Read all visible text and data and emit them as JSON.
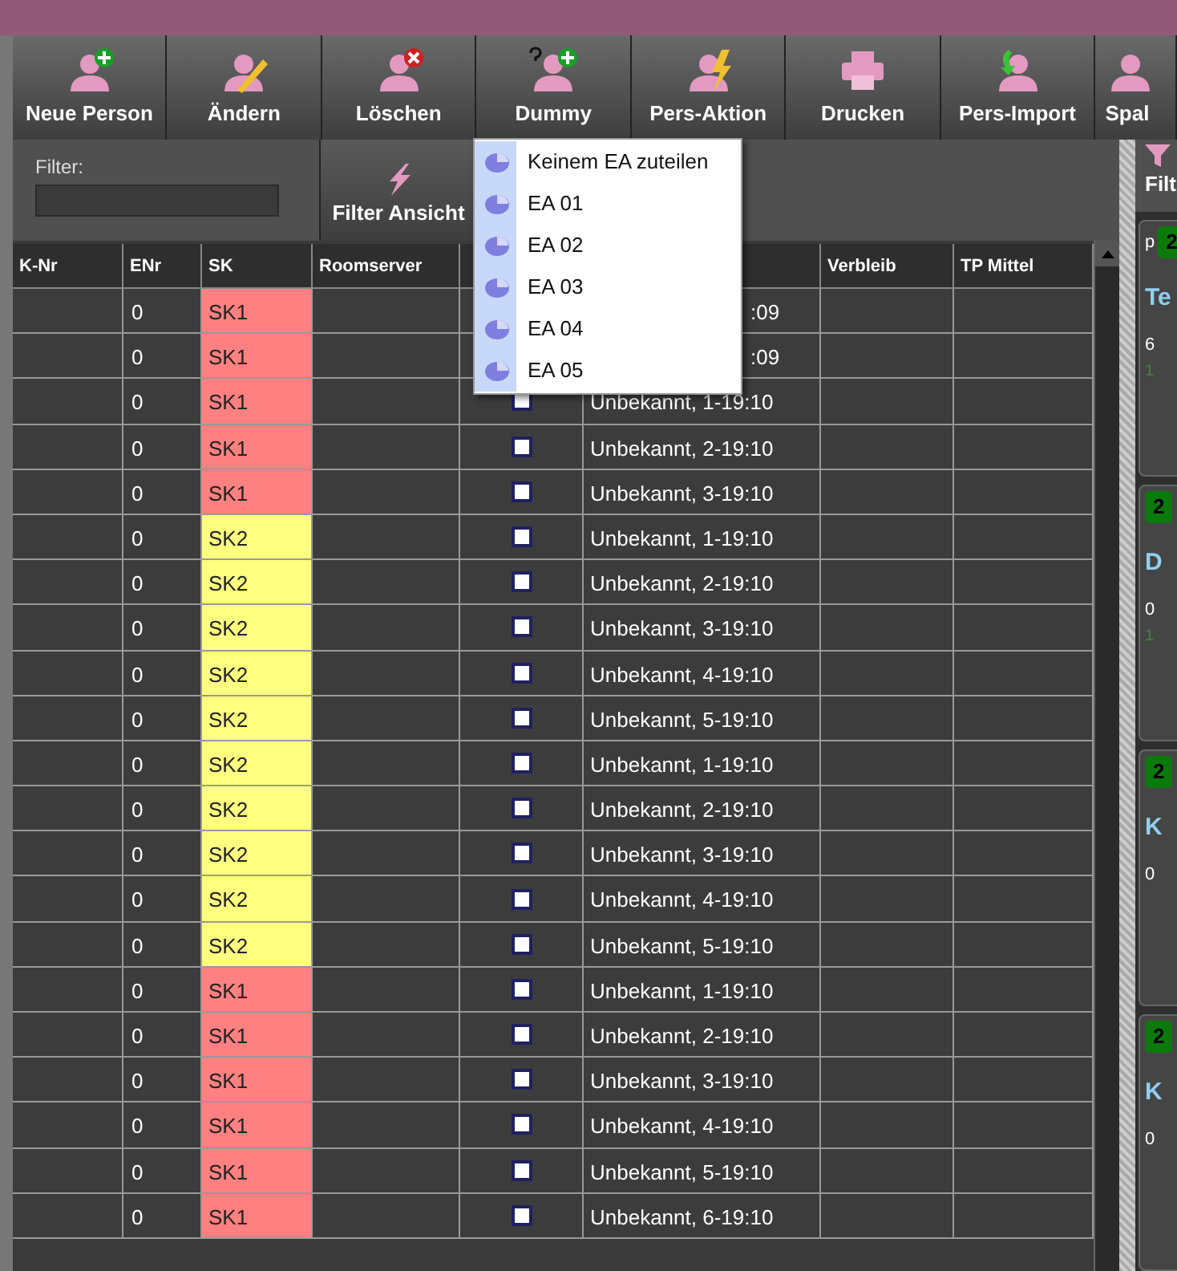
{
  "toolbar": [
    {
      "label": "Neue Person",
      "kind": "add"
    },
    {
      "label": "Ändern",
      "kind": "edit"
    },
    {
      "label": "Löschen",
      "kind": "delete"
    },
    {
      "label": "Dummy",
      "kind": "dummy"
    },
    {
      "label": "Pers-Aktion",
      "kind": "action"
    },
    {
      "label": "Drucken",
      "kind": "print"
    },
    {
      "label": "Pers-Import",
      "kind": "import"
    },
    {
      "label": "Spal",
      "kind": "columns"
    }
  ],
  "filter": {
    "label": "Filter:",
    "button": "Filter Ansicht"
  },
  "right_filter_button": "Filt",
  "menu": [
    "Keinem EA zuteilen",
    "EA 01",
    "EA 02",
    "EA 03",
    "EA 04",
    "EA 05"
  ],
  "table": {
    "columns": [
      "K-Nr",
      "ENr",
      "SK",
      "Roomserver",
      "",
      "",
      "Verbleib",
      "TP Mittel"
    ],
    "rows": [
      {
        "enr": "0",
        "sk": "SK1",
        "color": "#ff8080",
        "covered": true,
        "status": ":09"
      },
      {
        "enr": "0",
        "sk": "SK1",
        "color": "#ff8080",
        "covered": true,
        "status": ":09"
      },
      {
        "enr": "0",
        "sk": "SK1",
        "color": "#ff8080",
        "covered": false,
        "checked": false,
        "status": "Unbekannt, 1-19:10"
      },
      {
        "enr": "0",
        "sk": "SK1",
        "color": "#ff8080",
        "covered": false,
        "checked": false,
        "status": "Unbekannt, 2-19:10"
      },
      {
        "enr": "0",
        "sk": "SK1",
        "color": "#ff8080",
        "covered": false,
        "checked": false,
        "status": "Unbekannt, 3-19:10"
      },
      {
        "enr": "0",
        "sk": "SK2",
        "color": "#ffff80",
        "covered": false,
        "checked": false,
        "status": "Unbekannt, 1-19:10"
      },
      {
        "enr": "0",
        "sk": "SK2",
        "color": "#ffff80",
        "covered": false,
        "checked": false,
        "status": "Unbekannt, 2-19:10"
      },
      {
        "enr": "0",
        "sk": "SK2",
        "color": "#ffff80",
        "covered": false,
        "checked": false,
        "status": "Unbekannt, 3-19:10"
      },
      {
        "enr": "0",
        "sk": "SK2",
        "color": "#ffff80",
        "covered": false,
        "checked": false,
        "status": "Unbekannt, 4-19:10"
      },
      {
        "enr": "0",
        "sk": "SK2",
        "color": "#ffff80",
        "covered": false,
        "checked": false,
        "status": "Unbekannt, 5-19:10"
      },
      {
        "enr": "0",
        "sk": "SK2",
        "color": "#ffff80",
        "covered": false,
        "checked": false,
        "status": "Unbekannt, 1-19:10"
      },
      {
        "enr": "0",
        "sk": "SK2",
        "color": "#ffff80",
        "covered": false,
        "checked": false,
        "status": "Unbekannt, 2-19:10"
      },
      {
        "enr": "0",
        "sk": "SK2",
        "color": "#ffff80",
        "covered": false,
        "checked": false,
        "status": "Unbekannt, 3-19:10"
      },
      {
        "enr": "0",
        "sk": "SK2",
        "color": "#ffff80",
        "covered": false,
        "checked": false,
        "status": "Unbekannt, 4-19:10"
      },
      {
        "enr": "0",
        "sk": "SK2",
        "color": "#ffff80",
        "covered": false,
        "checked": false,
        "status": "Unbekannt, 5-19:10"
      },
      {
        "enr": "0",
        "sk": "SK1",
        "color": "#ff8080",
        "covered": false,
        "checked": false,
        "status": "Unbekannt, 1-19:10"
      },
      {
        "enr": "0",
        "sk": "SK1",
        "color": "#ff8080",
        "covered": false,
        "checked": false,
        "status": "Unbekannt, 2-19:10"
      },
      {
        "enr": "0",
        "sk": "SK1",
        "color": "#ff8080",
        "covered": false,
        "checked": false,
        "status": "Unbekannt, 3-19:10"
      },
      {
        "enr": "0",
        "sk": "SK1",
        "color": "#ff8080",
        "covered": false,
        "checked": false,
        "status": "Unbekannt, 4-19:10"
      },
      {
        "enr": "0",
        "sk": "SK1",
        "color": "#ff8080",
        "covered": false,
        "checked": false,
        "status": "Unbekannt, 5-19:10"
      },
      {
        "enr": "0",
        "sk": "SK1",
        "color": "#ff8080",
        "covered": false,
        "checked": false,
        "status": "Unbekannt, 6-19:10"
      }
    ]
  },
  "cards": [
    {
      "prefix": "p",
      "badge": "2",
      "title": "Te",
      "value": "6",
      "note": "1"
    },
    {
      "badge": "2",
      "title": "D",
      "value": "0",
      "note": "1"
    },
    {
      "badge": "2",
      "title": "K",
      "value": "0"
    },
    {
      "badge": "2",
      "title": "K",
      "value": "0"
    }
  ]
}
